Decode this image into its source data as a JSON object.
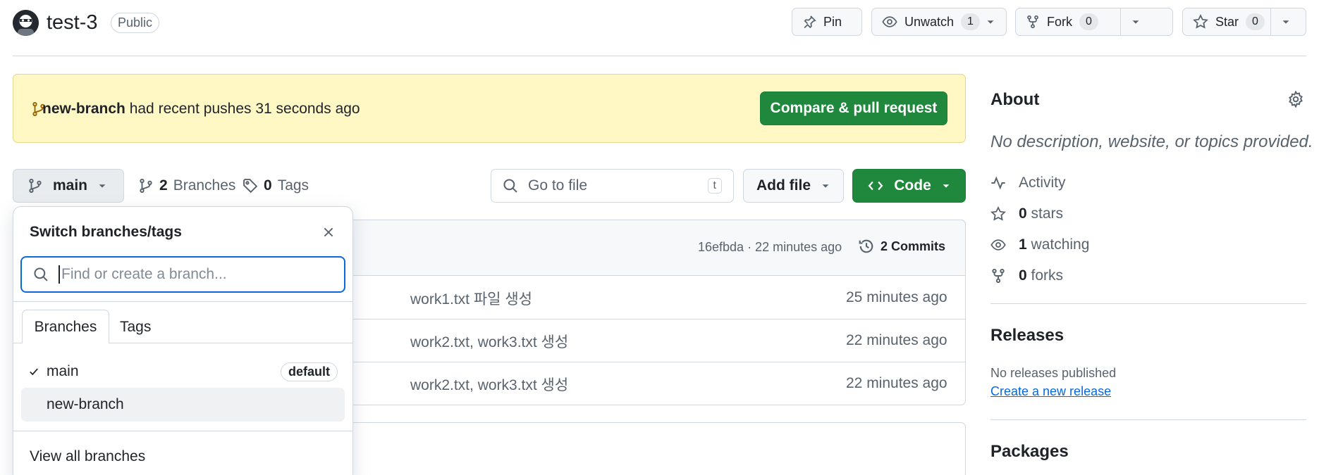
{
  "repo": {
    "name": "test-3",
    "visibility": "Public"
  },
  "header_actions": {
    "pin": "Pin",
    "unwatch": "Unwatch",
    "watch_count": "1",
    "fork": "Fork",
    "fork_count": "0",
    "star": "Star",
    "star_count": "0"
  },
  "banner": {
    "branch": "new-branch",
    "message": "had recent pushes 31 seconds ago",
    "button": "Compare & pull request"
  },
  "toolbar": {
    "current_branch": "main",
    "branches_count": "2",
    "branches_label": "Branches",
    "tags_count": "0",
    "tags_label": "Tags",
    "goto_placeholder": "Go to file",
    "goto_shortcut": "t",
    "add_file": "Add file",
    "code": "Code"
  },
  "commit_header": {
    "meta": "16efbda · 22 minutes ago",
    "commits": "2 Commits"
  },
  "files": [
    {
      "message": "work1.txt 파일 생성",
      "time": "25 minutes ago"
    },
    {
      "message": "work2.txt, work3.txt 생성",
      "time": "22 minutes ago"
    },
    {
      "message": "work2.txt, work3.txt 생성",
      "time": "22 minutes ago"
    }
  ],
  "dropdown": {
    "title": "Switch branches/tags",
    "search_placeholder": "Find or create a branch...",
    "tabs": [
      "Branches",
      "Tags"
    ],
    "branches": [
      {
        "name": "main",
        "selected": true,
        "badge": "default"
      },
      {
        "name": "new-branch",
        "selected": false,
        "badge": ""
      }
    ],
    "view_all": "View all branches"
  },
  "sidebar": {
    "about": "About",
    "description": "No description, website, or topics provided.",
    "activity": "Activity",
    "stars_count": "0",
    "stars_label": "stars",
    "watching_count": "1",
    "watching_label": "watching",
    "forks_count": "0",
    "forks_label": "forks",
    "releases": "Releases",
    "no_releases": "No releases published",
    "create_release": "Create a new release",
    "packages": "Packages"
  },
  "colors": {
    "accent_green": "#1f883d",
    "link_blue": "#0969da",
    "banner_bg": "#fff8c5",
    "border": "#d0d7de"
  }
}
